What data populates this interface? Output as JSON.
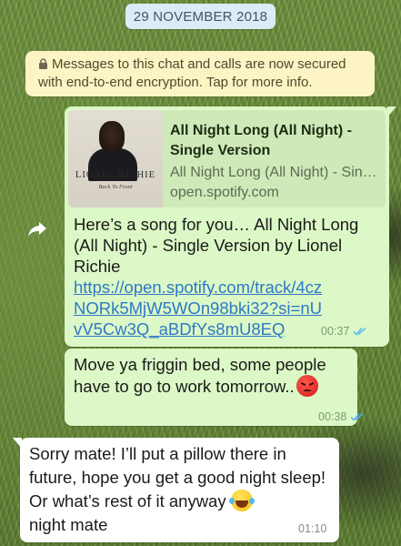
{
  "date_label": "29 NOVEMBER 2018",
  "encryption_notice": "Messages to this chat and calls are now secured with end-to-end encryption. Tap for more info.",
  "colors": {
    "outgoing_bubble": "#dcf8c6",
    "incoming_bubble": "#ffffff",
    "link": "#2d79c7",
    "read_ticks": "#4fb3f6"
  },
  "messages": [
    {
      "direction": "outgoing",
      "preview": {
        "album_artist": "LIONEL RICHIE",
        "album_subtitle": "Back To Front",
        "title": "All Night Long (All Night) - Single Version",
        "description": "All Night Long (All Night) - Single Version",
        "site": "open.spotify.com"
      },
      "text": "Here’s a song for you… All Night Long (All Night) - Single Version by Lionel Richie",
      "link": "https://open.spotify.com/track/4czNORk5MjW5WOn98bki32?si=nUvV5Cw3Q_aBDfYs8mU8EQ",
      "time": "00:37",
      "status_icon": "double-tick-read-icon"
    },
    {
      "direction": "outgoing",
      "text": "Move ya friggin bed, some people have to go to work tomorrow..",
      "emoji": "angry-face",
      "time": "00:38",
      "status_icon": "double-tick-read-icon"
    },
    {
      "direction": "incoming",
      "text_a": "Sorry mate! I’ll put a pillow there in future, hope you get a good night sleep! Or what’s rest of it anyway",
      "emoji": "tears-of-joy-face",
      "text_b": "night mate",
      "time": "01:10"
    }
  ]
}
